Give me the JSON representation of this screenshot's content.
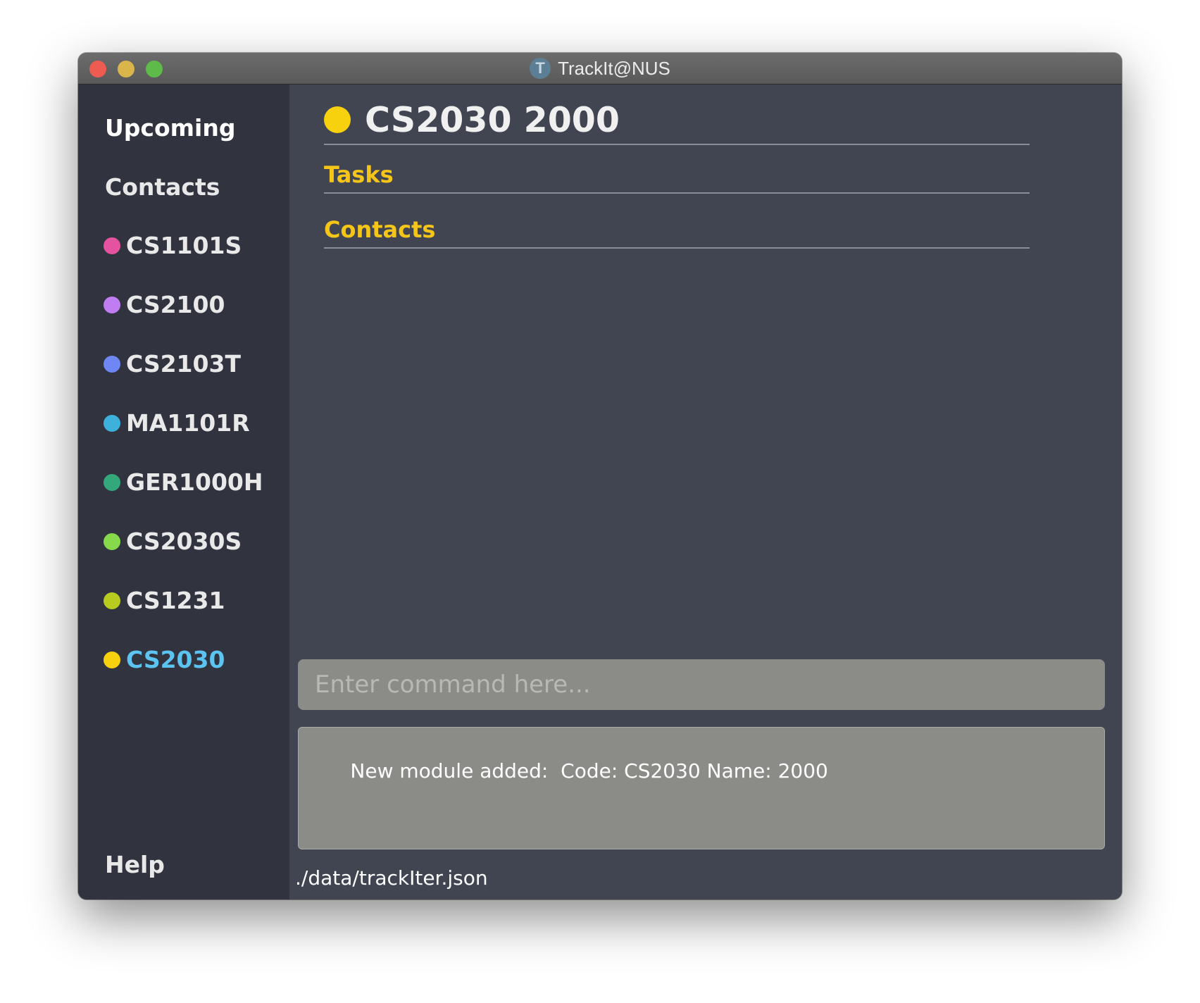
{
  "window": {
    "title": "TrackIt@NUS",
    "app_icon_letter": "T"
  },
  "sidebar": {
    "upcoming_label": "Upcoming",
    "contacts_label": "Contacts",
    "help_label": "Help",
    "modules": [
      {
        "code": "CS1101S",
        "color": "#e5529f"
      },
      {
        "code": "CS2100",
        "color": "#c07df2"
      },
      {
        "code": "CS2103T",
        "color": "#6f86f5"
      },
      {
        "code": "MA1101R",
        "color": "#3eb0dc"
      },
      {
        "code": "GER1000H",
        "color": "#33a87b"
      },
      {
        "code": "CS2030S",
        "color": "#86d94a"
      },
      {
        "code": "CS1231",
        "color": "#b7cc1f"
      },
      {
        "code": "CS2030",
        "color": "#f7d10e",
        "active": true
      }
    ]
  },
  "main": {
    "header": {
      "title": "CS2030 2000",
      "dot_color": "#f7d10e"
    },
    "sections": [
      {
        "label": "Tasks"
      },
      {
        "label": "Contacts"
      }
    ],
    "command": {
      "placeholder": "Enter command here...",
      "value": ""
    },
    "result": {
      "text": "New module added:  Code: CS2030 Name: 2000"
    },
    "status_bar": {
      "path": "./data/trackIter.json"
    }
  }
}
